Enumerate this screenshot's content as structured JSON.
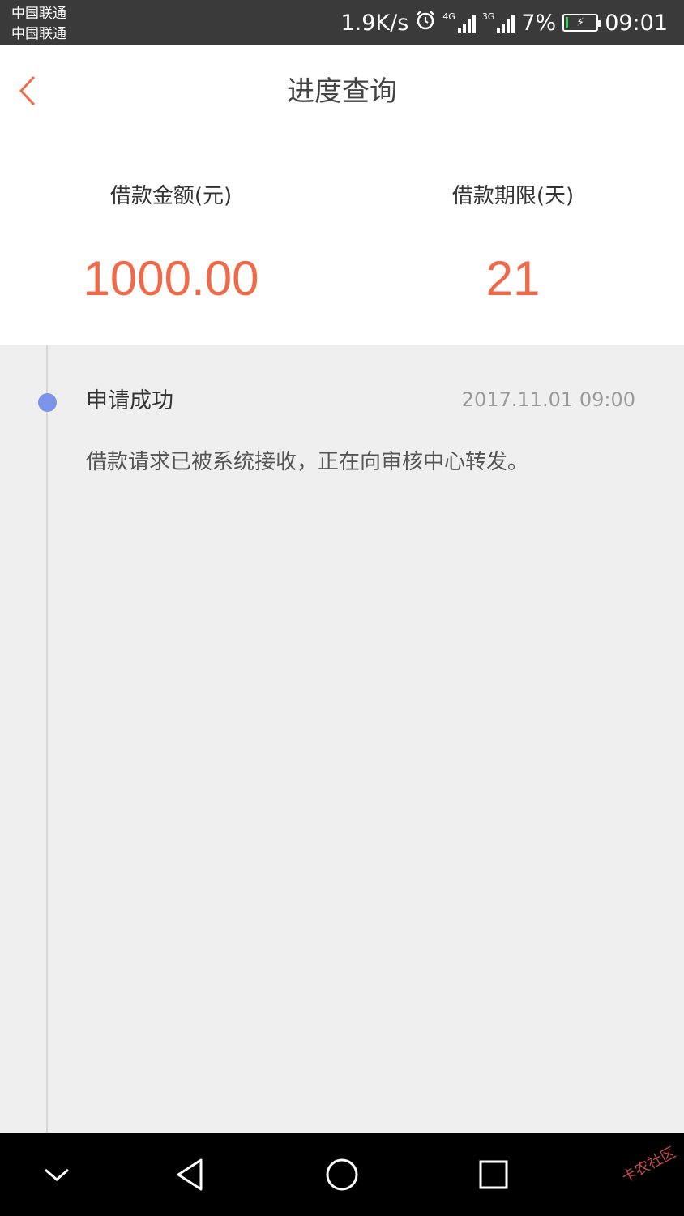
{
  "status_bar": {
    "carrier_1": "中国联通",
    "carrier_2": "中国联通",
    "net_speed": "1.9K/s",
    "signal_1_label": "4G",
    "signal_2_label": "3G",
    "battery_percent": "7%",
    "time": "09:01",
    "battery_level": 0.07,
    "battery_charging_color": "#42c95a"
  },
  "header": {
    "back_icon": "chevron-left-icon",
    "title": "进度查询"
  },
  "loan_info": {
    "amount_label": "借款金额(元)",
    "amount_value": "1000.00",
    "term_label": "借款期限(天)",
    "term_value": "21"
  },
  "timeline": {
    "events": [
      {
        "title": "申请成功",
        "time": "2017.11.01 09:00",
        "description": "借款请求已被系统接收，正在向审核中心转发。"
      }
    ]
  },
  "nav_bar": {
    "buttons": [
      "collapse-icon",
      "back-triangle-icon",
      "home-circle-icon",
      "recents-square-icon"
    ]
  },
  "watermark": {
    "text": "卡农社区"
  },
  "colors": {
    "accent": "#f06a4a",
    "timeline_dot": "#7b93e8",
    "status_bar_bg": "#3a3a3a",
    "page_bg": "#efefef"
  }
}
